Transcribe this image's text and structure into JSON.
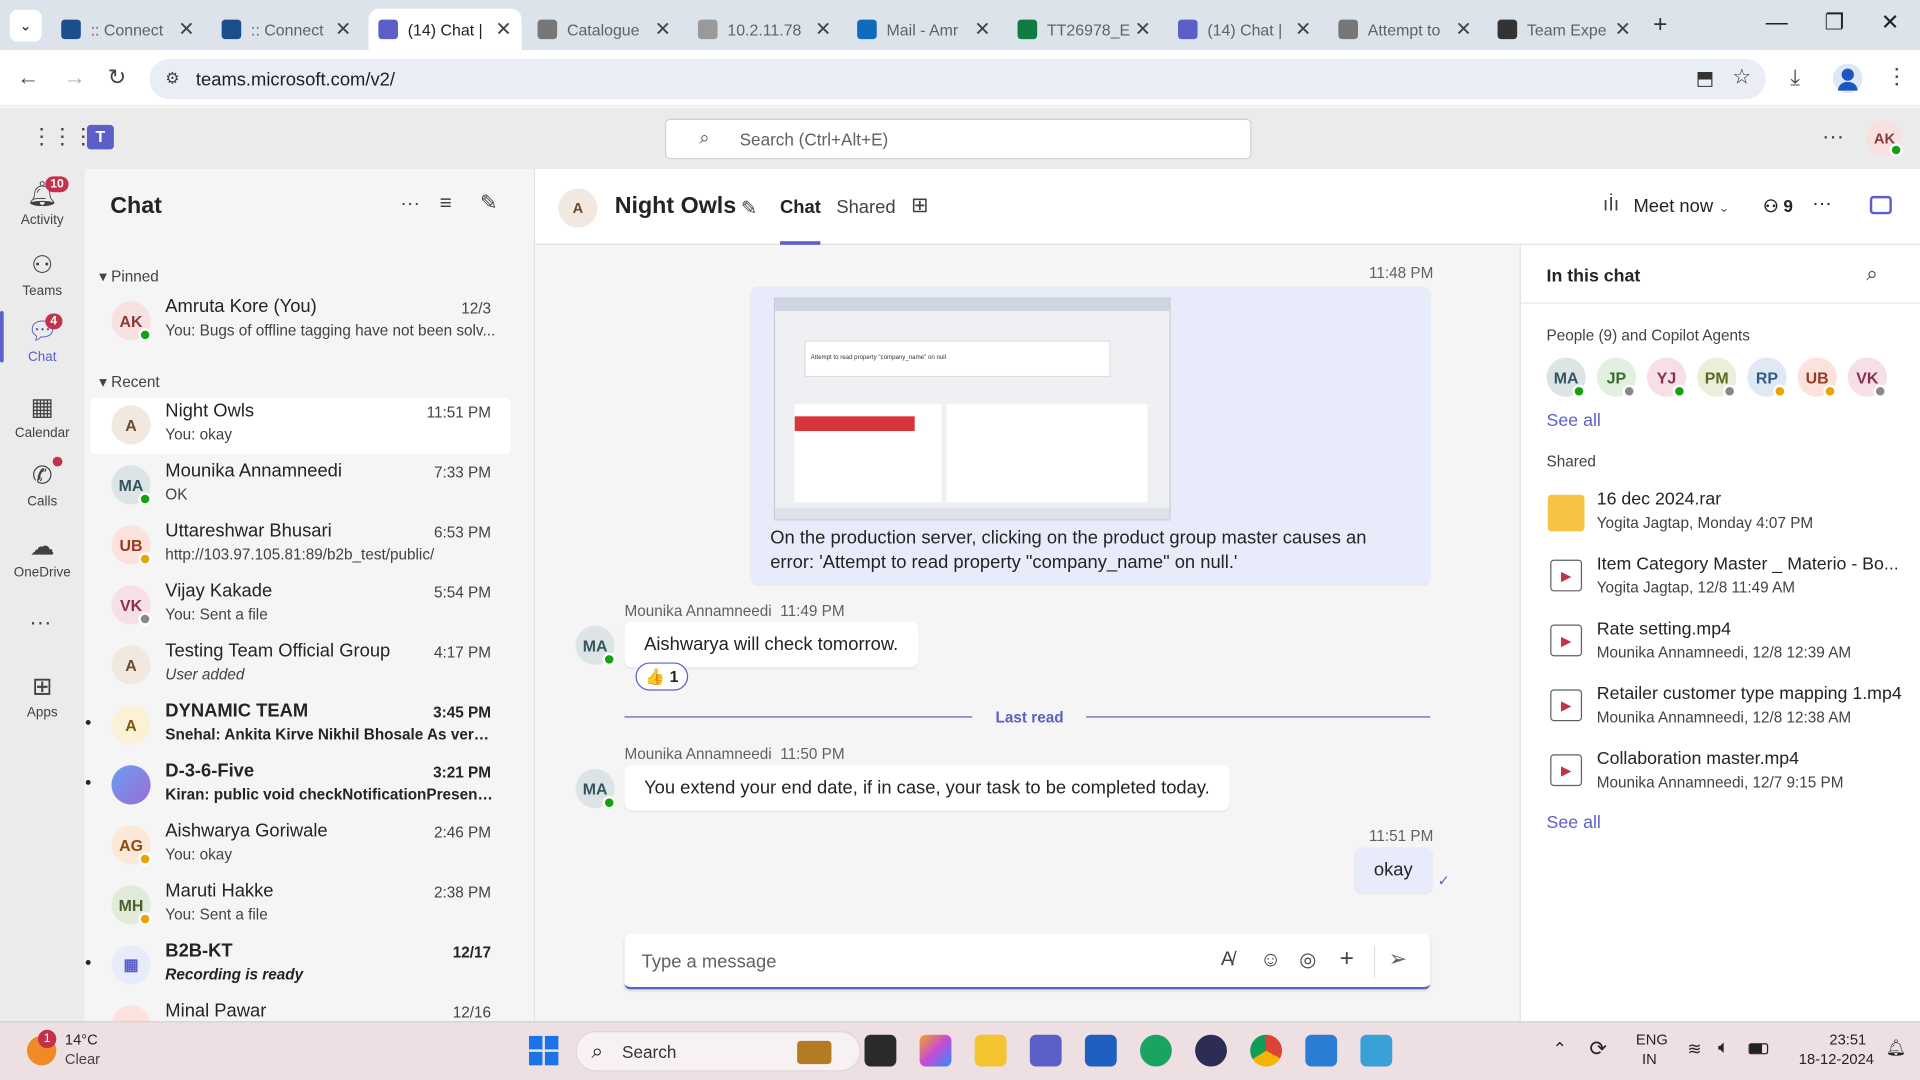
{
  "browser": {
    "tabs": [
      {
        "title": ":: Connect",
        "active": false,
        "icon": "react-icon",
        "color": "#1d4e89"
      },
      {
        "title": ":: Connect",
        "active": false,
        "icon": "react-icon",
        "color": "#1d4e89"
      },
      {
        "title": "(14) Chat |",
        "active": true,
        "icon": "teams-icon",
        "color": "#5b5fc7"
      },
      {
        "title": "Catalogue",
        "active": false,
        "icon": "globe-icon",
        "color": "#777"
      },
      {
        "title": "10.2.11.78",
        "active": false,
        "icon": "gmail-icon",
        "color": "#999"
      },
      {
        "title": "Mail - Amr",
        "active": false,
        "icon": "outlook-icon",
        "color": "#0f6cbd"
      },
      {
        "title": "TT26978_E",
        "active": false,
        "icon": "excel-icon",
        "color": "#107c41"
      },
      {
        "title": "(14) Chat |",
        "active": false,
        "icon": "teams-icon",
        "color": "#5b5fc7"
      },
      {
        "title": "Attempt to",
        "active": false,
        "icon": "globe-icon",
        "color": "#777"
      },
      {
        "title": "Team Expe",
        "active": false,
        "icon": "chatgpt-icon",
        "color": "#333"
      }
    ],
    "url": "teams.microsoft.com/v2/"
  },
  "teams": {
    "search_placeholder": "Search (Ctrl+Alt+E)",
    "user_initials": "AK"
  },
  "rail": [
    {
      "label": "Activity",
      "icon": "bell-icon",
      "badge": "10"
    },
    {
      "label": "Teams",
      "icon": "teams-people-icon",
      "badge": ""
    },
    {
      "label": "Chat",
      "icon": "chat-icon",
      "badge": "4"
    },
    {
      "label": "Calendar",
      "icon": "calendar-icon",
      "badge": ""
    },
    {
      "label": "Calls",
      "icon": "phone-icon",
      "badge": ""
    },
    {
      "label": "OneDrive",
      "icon": "cloud-icon",
      "badge": ""
    },
    {
      "label": "Apps",
      "icon": "apps-icon",
      "badge": ""
    }
  ],
  "chatlist": {
    "title": "Chat",
    "pinned_label": "Pinned",
    "recent_label": "Recent",
    "pinned": [
      {
        "name": "Amruta Kore (You)",
        "time": "12/3",
        "preview": "You: Bugs of offline tagging have not been solv...",
        "initials": "AK",
        "avbg": "#f7e1e1",
        "avfg": "#8a3a3a",
        "status": "#13a10e"
      }
    ],
    "recent": [
      {
        "name": "Night Owls",
        "time": "11:51 PM",
        "preview": "You: okay",
        "initials": "A",
        "avbg": "#f1e9e0",
        "avfg": "#6b4a2c",
        "status": "",
        "bold": false,
        "selected": true
      },
      {
        "name": "Mounika Annamneedi",
        "time": "7:33 PM",
        "preview": "OK",
        "initials": "MA",
        "avbg": "#dde4e6",
        "avfg": "#335661",
        "status": "#13a10e",
        "bold": false
      },
      {
        "name": "Uttareshwar Bhusari",
        "time": "6:53 PM",
        "preview": "http://103.97.105.81:89/b2b_test/public/",
        "initials": "UB",
        "avbg": "#fbe2dc",
        "avfg": "#9a3a25",
        "status": "#eaa300",
        "bold": false
      },
      {
        "name": "Vijay Kakade",
        "time": "5:54 PM",
        "preview": "You: Sent a file",
        "initials": "VK",
        "avbg": "#f6dfe6",
        "avfg": "#8a2f4d",
        "status": "#8a8886",
        "bold": false
      },
      {
        "name": "Testing Team Official Group",
        "time": "4:17 PM",
        "preview": "User added",
        "initials": "A",
        "avbg": "#f1e9e0",
        "avfg": "#6b4a2c",
        "status": "",
        "bold": false,
        "italic": true
      },
      {
        "name": "DYNAMIC TEAM",
        "time": "3:45 PM",
        "preview": "Snehal:  Ankita Kirve  Nikhil Bhosale  As verba...",
        "initials": "A",
        "avbg": "#fbf1d6",
        "avfg": "#7a5b10",
        "status": "",
        "bold": true
      },
      {
        "name": "D-3-6-Five",
        "time": "3:21 PM",
        "preview": "Kiran: public void checkNotificationPresenceA...",
        "initials": "",
        "avbg": "#8a7ad6",
        "avfg": "#fff",
        "status": "",
        "bold": true
      },
      {
        "name": "Aishwarya Goriwale",
        "time": "2:46 PM",
        "preview": "You: okay",
        "initials": "AG",
        "avbg": "#fbe9d8",
        "avfg": "#8a4a14",
        "status": "#eaa300",
        "bold": false
      },
      {
        "name": "Maruti Hakke",
        "time": "2:38 PM",
        "preview": "You: Sent a file",
        "initials": "MH",
        "avbg": "#e2ead9",
        "avfg": "#4a6128",
        "status": "#eaa300",
        "bold": false
      },
      {
        "name": "B2B-KT",
        "time": "12/17",
        "preview": "Recording is ready",
        "initials": "",
        "avbg": "#e8ebfa",
        "avfg": "#5b5fc7",
        "status": "",
        "bold": true,
        "italic": true
      },
      {
        "name": "Minal Pawar",
        "time": "12/16",
        "preview": "",
        "initials": "",
        "avbg": "#fbe2dc",
        "avfg": "#9a3a25",
        "status": "",
        "bold": false
      }
    ]
  },
  "conversation": {
    "title": "Night Owls",
    "tabs": [
      "Chat",
      "Shared"
    ],
    "meet_now": "Meet now",
    "participants_count": "9",
    "screenshot_caption_title": "Attempt to read property \"company_name\" on null",
    "messages": [
      {
        "kind": "me",
        "time": "11:48 PM",
        "text": "On the production server, clicking on the product group master causes an error: 'Attempt to read property \"company_name\" on null.'"
      },
      {
        "kind": "other",
        "author": "Mounika Annamneedi",
        "time": "11:49 PM",
        "text": "Aishwarya will check tomorrow.",
        "reaction": "👍",
        "reaction_count": "1",
        "initials": "MA"
      },
      {
        "kind": "other",
        "author": "Mounika Annamneedi",
        "time": "11:50 PM",
        "text": "You extend your end date, if in case, your task to be completed today.",
        "initials": "MA"
      },
      {
        "kind": "me",
        "time": "11:51 PM",
        "text": "okay"
      }
    ],
    "last_read": "Last read",
    "compose_placeholder": "Type a message"
  },
  "panel": {
    "title": "In this chat",
    "people_label": "People (9) and Copilot Agents",
    "people": [
      {
        "i": "MA",
        "bg": "#dde4e6",
        "fg": "#335661",
        "st": "#13a10e"
      },
      {
        "i": "JP",
        "bg": "#e2f0e0",
        "fg": "#3b6a2e",
        "st": "#8a8886"
      },
      {
        "i": "YJ",
        "bg": "#f6dfe6",
        "fg": "#8a2f4d",
        "st": "#13a10e"
      },
      {
        "i": "PM",
        "bg": "#e9efd9",
        "fg": "#5a6a24",
        "st": "#8a8886"
      },
      {
        "i": "RP",
        "bg": "#dfe8f3",
        "fg": "#2f5a8a",
        "st": "#eaa300"
      },
      {
        "i": "UB",
        "bg": "#fbe2dc",
        "fg": "#9a3a25",
        "st": "#eaa300"
      },
      {
        "i": "VK",
        "bg": "#f6dfe6",
        "fg": "#8a2f4d",
        "st": "#8a8886"
      }
    ],
    "see_all": "See all",
    "shared_label": "Shared",
    "shared": [
      {
        "name": "16 dec 2024.rar",
        "sub": "Yogita Jagtap, Monday 4:07 PM",
        "icon": "folder-zip-icon"
      },
      {
        "name": "Item Category Master _ Materio - Bo...",
        "sub": "Yogita Jagtap, 12/8 11:49 AM",
        "icon": "video-icon"
      },
      {
        "name": "Rate setting.mp4",
        "sub": "Mounika Annamneedi, 12/8 12:39 AM",
        "icon": "video-icon"
      },
      {
        "name": "Retailer customer type mapping 1.mp4",
        "sub": "Mounika Annamneedi, 12/8 12:38 AM",
        "icon": "video-icon"
      },
      {
        "name": "Collaboration master.mp4",
        "sub": "Mounika Annamneedi, 12/7 9:15 PM",
        "icon": "video-icon"
      }
    ],
    "see_all_2": "See all"
  },
  "taskbar": {
    "weather_temp": "14°C",
    "weather_text": "Clear",
    "weather_badge": "1",
    "search": "Search",
    "lang1": "ENG",
    "lang2": "IN",
    "time": "23:51",
    "date": "18-12-2024"
  }
}
